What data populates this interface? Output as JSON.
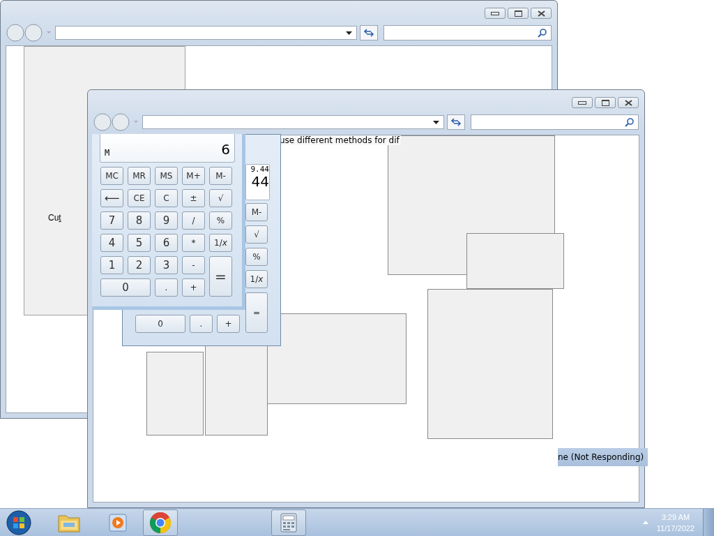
{
  "back_window": {
    "menu_item": "Cut"
  },
  "front_window": {
    "text_fragment": "use different methods for dif"
  },
  "calculator_behind": {
    "expression": "9.44",
    "value": "44",
    "side_keys": [
      "M-",
      "√",
      "%",
      "1/*x*"
    ],
    "equals_key": "=",
    "bottom_keys": [
      "0",
      ".",
      "+"
    ]
  },
  "calculator": {
    "memory_indicator": "M",
    "display": "6",
    "keys": [
      {
        "label": "MC",
        "kind": "memory"
      },
      {
        "label": "MR",
        "kind": "memory"
      },
      {
        "label": "MS",
        "kind": "memory"
      },
      {
        "label": "M+",
        "kind": "memory"
      },
      {
        "label": "M-",
        "kind": "memory"
      },
      {
        "label": "⟵",
        "kind": "key"
      },
      {
        "label": "CE",
        "kind": "memory"
      },
      {
        "label": "C",
        "kind": "memory"
      },
      {
        "label": "±",
        "kind": "memory"
      },
      {
        "label": "√",
        "kind": "memory"
      },
      {
        "label": "7",
        "kind": "key"
      },
      {
        "label": "8",
        "kind": "key"
      },
      {
        "label": "9",
        "kind": "key"
      },
      {
        "label": "/",
        "kind": "memory"
      },
      {
        "label": "%",
        "kind": "memory"
      },
      {
        "label": "4",
        "kind": "key"
      },
      {
        "label": "5",
        "kind": "key"
      },
      {
        "label": "6",
        "kind": "key"
      },
      {
        "label": "*",
        "kind": "memory"
      },
      {
        "label": "1/*x*",
        "kind": "memory"
      },
      {
        "label": "1",
        "kind": "key"
      },
      {
        "label": "2",
        "kind": "key"
      },
      {
        "label": "3",
        "kind": "key"
      },
      {
        "label": "-",
        "kind": "memory"
      },
      {
        "label": "=",
        "kind": "tall"
      },
      {
        "label": "0",
        "kind": "wide"
      },
      {
        "label": ".",
        "kind": "memory"
      },
      {
        "label": "+",
        "kind": "memory"
      }
    ]
  },
  "taskbar_button_fragment": "ne (Not Responding)",
  "taskbar": {
    "time": "3:29 AM",
    "date": "11/17/2022"
  }
}
